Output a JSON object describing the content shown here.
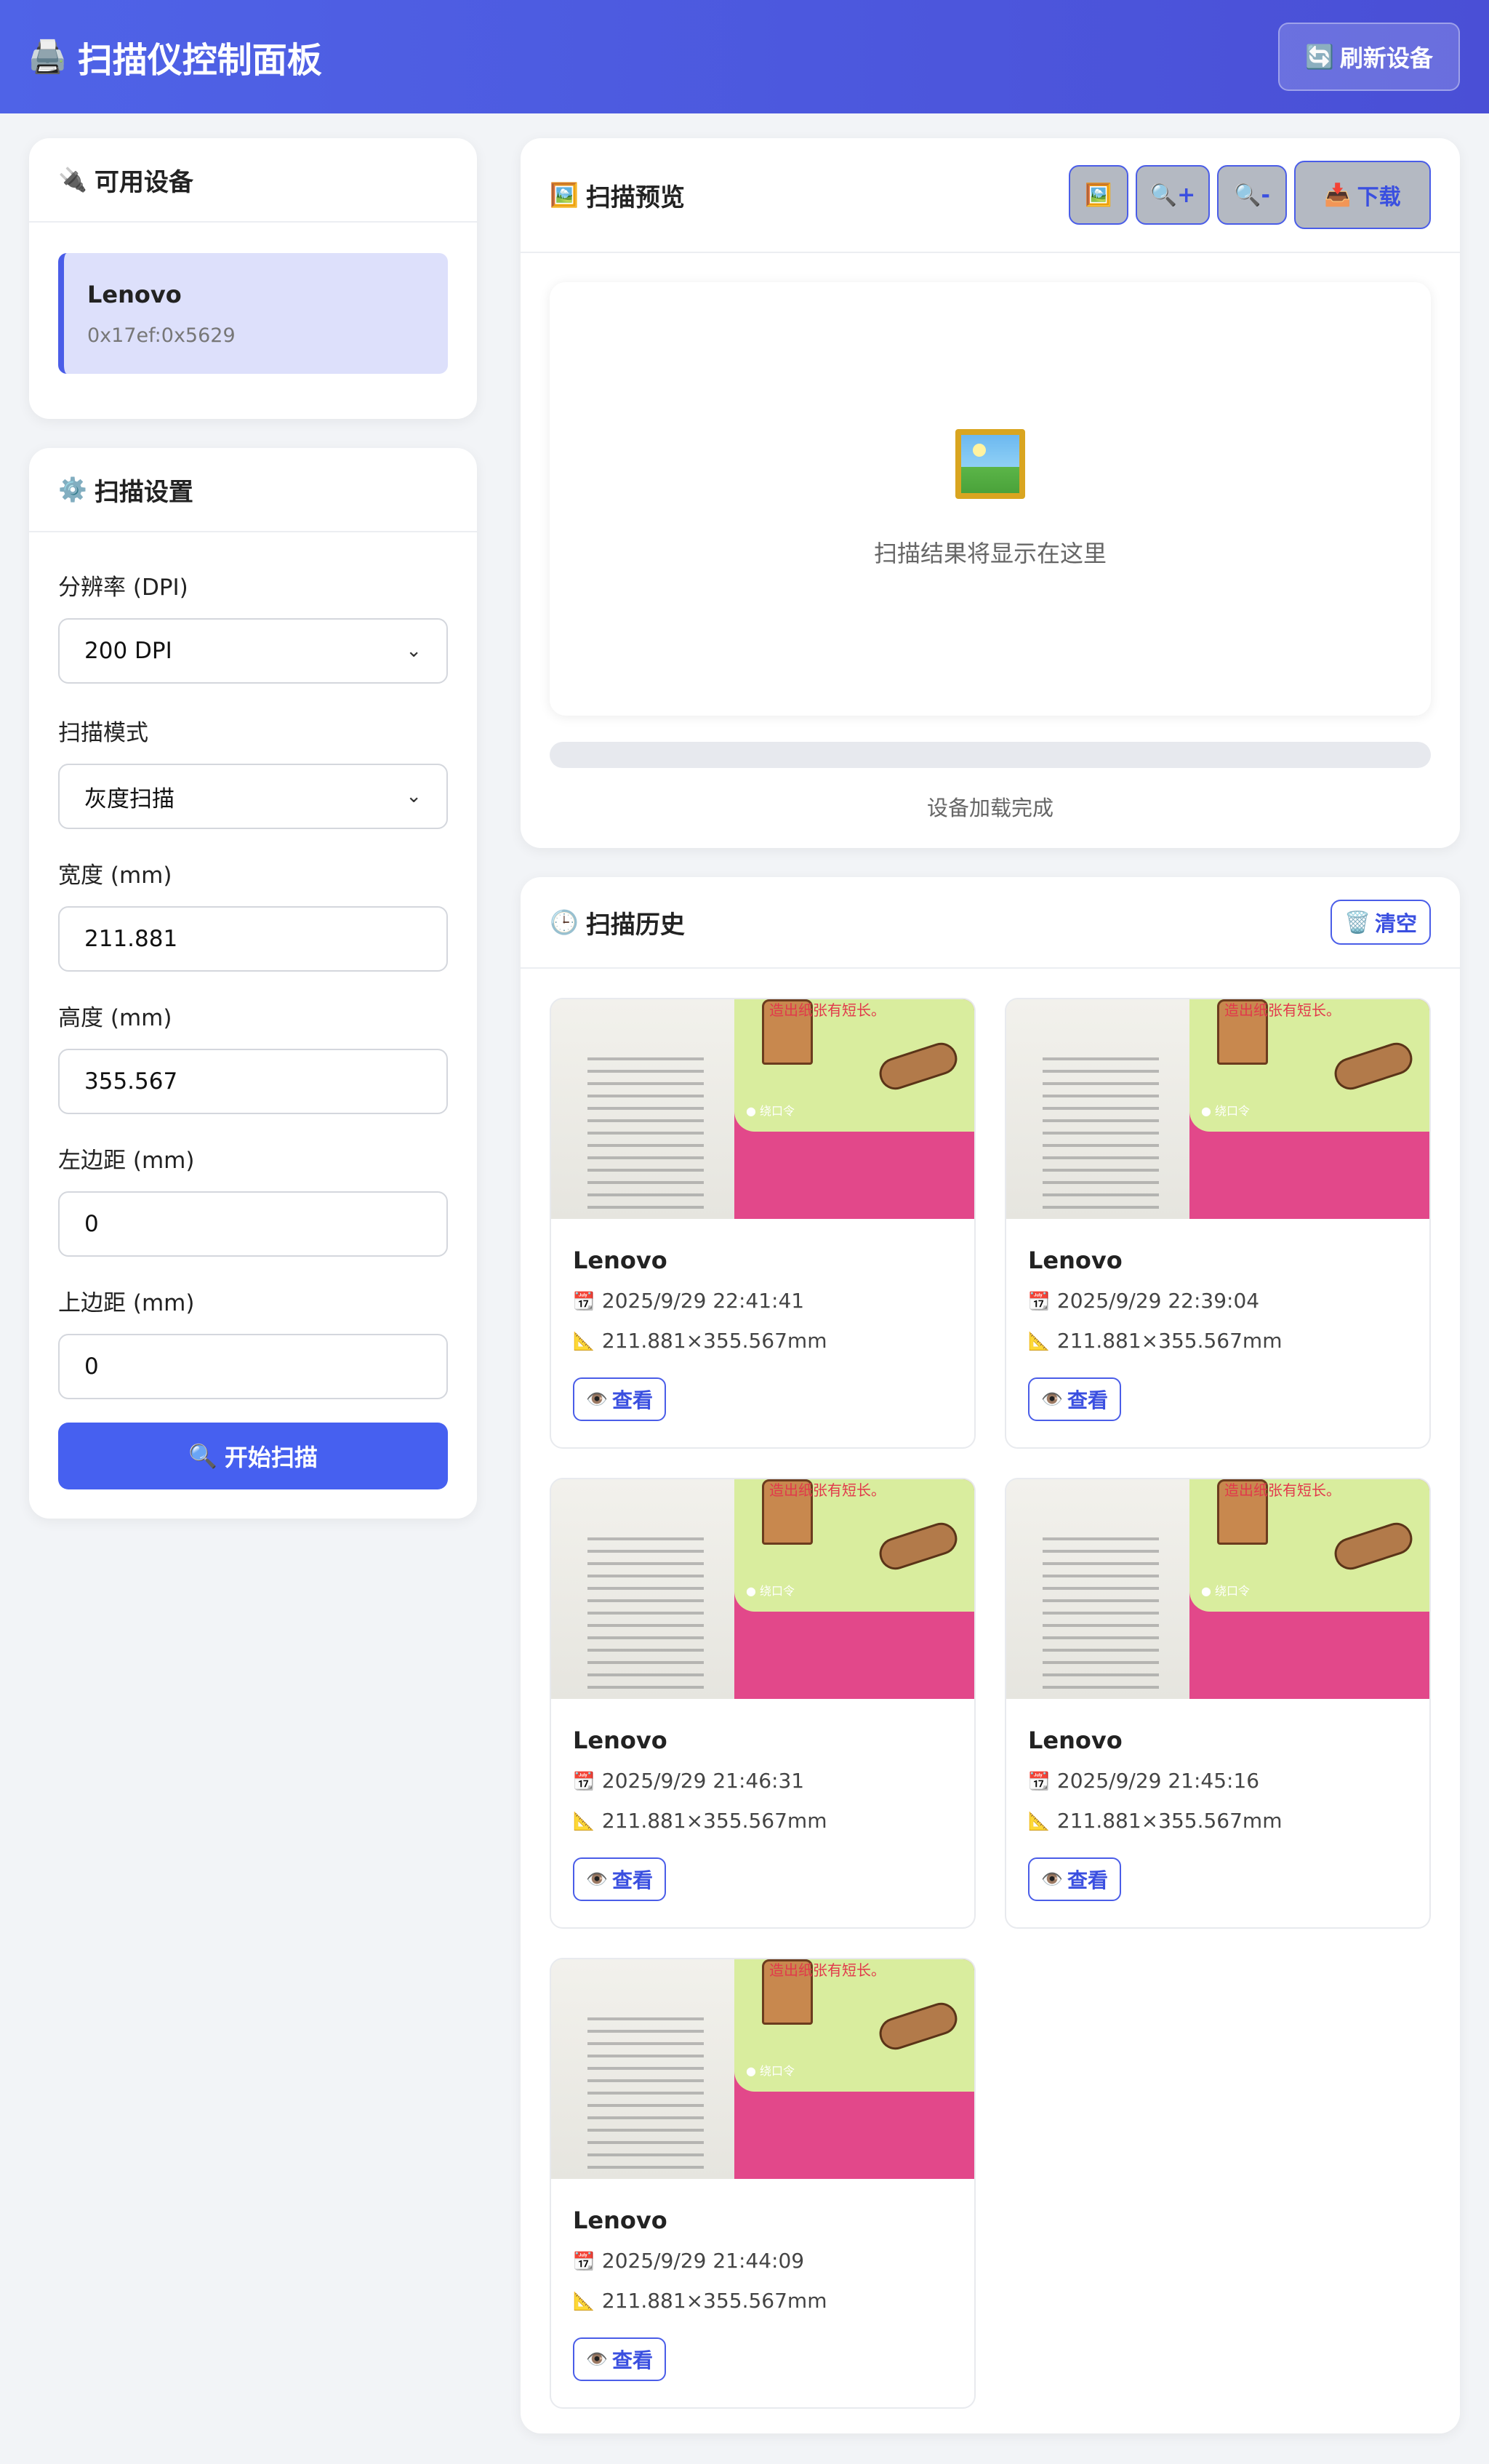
{
  "header": {
    "icon": "printer-icon",
    "title": "扫描仪控制面板",
    "refresh_icon": "refresh-icon",
    "refresh_label": "刷新设备"
  },
  "devices": {
    "icon": "plug-icon",
    "title": "可用设备",
    "items": [
      {
        "name": "Lenovo",
        "id": "0x17ef:0x5629"
      }
    ]
  },
  "settings": {
    "icon": "gear-icon",
    "title": "扫描设置",
    "resolution_label": "分辨率 (DPI)",
    "resolution_value": "200 DPI",
    "mode_label": "扫描模式",
    "mode_value": "灰度扫描",
    "width_label": "宽度 (mm)",
    "width_value": "211.881",
    "height_label": "高度 (mm)",
    "height_value": "355.567",
    "left_label": "左边距 (mm)",
    "left_value": "0",
    "top_label": "上边距 (mm)",
    "top_value": "0",
    "scan_icon": "magnifier-icon",
    "scan_label": "开始扫描"
  },
  "preview": {
    "icon": "picture-icon",
    "title": "扫描预览",
    "toolbar": {
      "fit_icon": "picture-icon",
      "zoom_in_icon": "zoom-in-icon",
      "zoom_out_icon": "zoom-out-icon",
      "download_icon": "download-icon",
      "download_label": "下载"
    },
    "placeholder_text": "扫描结果将显示在这里",
    "progress_fraction": 0,
    "status_text": "设备加载完成"
  },
  "history": {
    "icon": "clock-icon",
    "title": "扫描历史",
    "clear_icon": "trash-icon",
    "clear_label": "清空",
    "view_label": "查看",
    "thumb_text": "造出纸张有短长。",
    "thumb_label": "绕口令",
    "items": [
      {
        "device": "Lenovo",
        "datetime": "2025/9/29 22:41:41",
        "size": "211.881×355.567mm"
      },
      {
        "device": "Lenovo",
        "datetime": "2025/9/29 22:39:04",
        "size": "211.881×355.567mm"
      },
      {
        "device": "Lenovo",
        "datetime": "2025/9/29 21:46:31",
        "size": "211.881×355.567mm"
      },
      {
        "device": "Lenovo",
        "datetime": "2025/9/29 21:45:16",
        "size": "211.881×355.567mm"
      },
      {
        "device": "Lenovo",
        "datetime": "2025/9/29 21:44:09",
        "size": "211.881×355.567mm"
      }
    ]
  }
}
